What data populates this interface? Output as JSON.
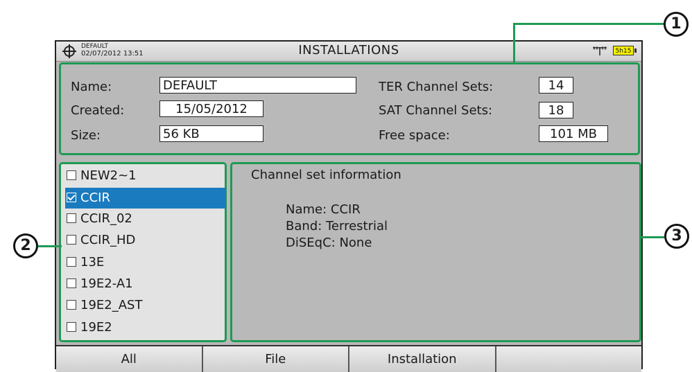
{
  "header": {
    "profile": "DEFAULT",
    "datetime": "02/07/2012 13:51",
    "title": "INSTALLATIONS",
    "battery": "5h15"
  },
  "info": {
    "name_label": "Name:",
    "name_value": "DEFAULT",
    "created_label": "Created:",
    "created_value": "15/05/2012",
    "size_label": "Size:",
    "size_value": "56 KB",
    "ter_label": "TER Channel Sets:",
    "ter_value": "14",
    "sat_label": "SAT Channel Sets:",
    "sat_value": "18",
    "free_label": "Free space:",
    "free_value": "101 MB"
  },
  "list": {
    "items": [
      {
        "label": "NEW2~1",
        "checked": false,
        "selected": false
      },
      {
        "label": "CCIR",
        "checked": true,
        "selected": true
      },
      {
        "label": "CCIR_02",
        "checked": false,
        "selected": false
      },
      {
        "label": "CCIR_HD",
        "checked": false,
        "selected": false
      },
      {
        "label": "13E",
        "checked": false,
        "selected": false
      },
      {
        "label": "19E2-A1",
        "checked": false,
        "selected": false
      },
      {
        "label": "19E2_AST",
        "checked": false,
        "selected": false
      },
      {
        "label": "19E2",
        "checked": false,
        "selected": false
      }
    ]
  },
  "detail": {
    "title": "Channel set information",
    "name_line": "Name: CCIR",
    "band_line": "Band: Terrestrial",
    "diseqc_line": "DiSEqC: None"
  },
  "softkeys": {
    "all": "All",
    "file": "File",
    "installation": "Installation",
    "empty": ""
  },
  "callouts": {
    "one": "1",
    "two": "2",
    "three": "3"
  },
  "colors": {
    "highlight": "#1f9a54",
    "selection": "#1a7bbf",
    "battery": "#f4ef00"
  }
}
